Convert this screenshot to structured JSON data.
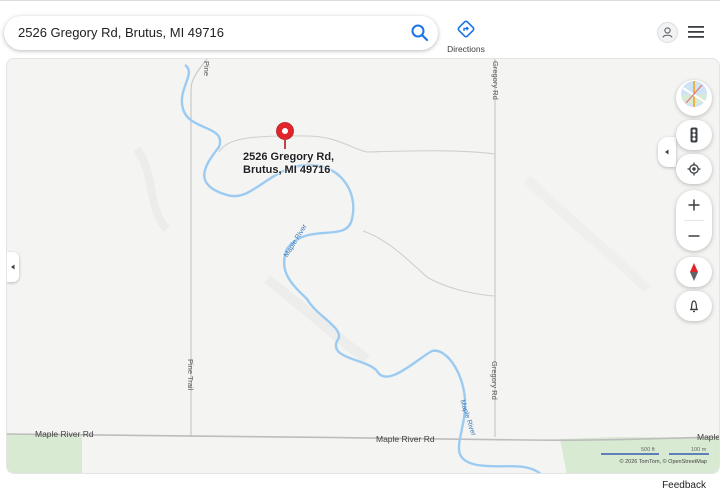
{
  "search": {
    "query": "2526 Gregory Rd, Brutus, MI 49716"
  },
  "toolbar": {
    "directions_label": "Directions"
  },
  "place": {
    "line1": "2526 Gregory Rd,",
    "line2": "Brutus, MI 49716"
  },
  "map_labels": {
    "pine_trail_top": "Pine",
    "gregory_rd_top": "Gregory Rd",
    "pine_trail": "Pine Trail",
    "gregory_rd": "Gregory Rd",
    "maple_river_rd_left": "Maple River Rd",
    "maple_river_rd_mid": "Maple River Rd",
    "maple_river_rd_right": "Maple Ri",
    "maple_river_1": "Maple River",
    "maple_river_2": "Maple River"
  },
  "scale": {
    "label_imperial": "500 ft",
    "label_metric": "100 m"
  },
  "attribution": "© 2026 TomTom, © OpenStreetMap",
  "footer": {
    "feedback_label": "Feedback"
  },
  "icons": {
    "search": "search-icon",
    "directions": "directions-icon",
    "avatar": "person-icon",
    "menu": "hamburger-menu-icon",
    "layers": "layers-icon",
    "traffic": "traffic-light-icon",
    "locate": "my-location-icon",
    "zoom_in": "plus-icon",
    "zoom_out": "minus-icon",
    "compass": "compass-icon",
    "street_view": "pegman-icon",
    "pin": "map-pin-icon"
  },
  "colors": {
    "water": "#9ccbf2",
    "pin": "#e2252c",
    "park": "#d8ead2",
    "road": "#c6c6c6",
    "accent": "#1a73e8"
  }
}
